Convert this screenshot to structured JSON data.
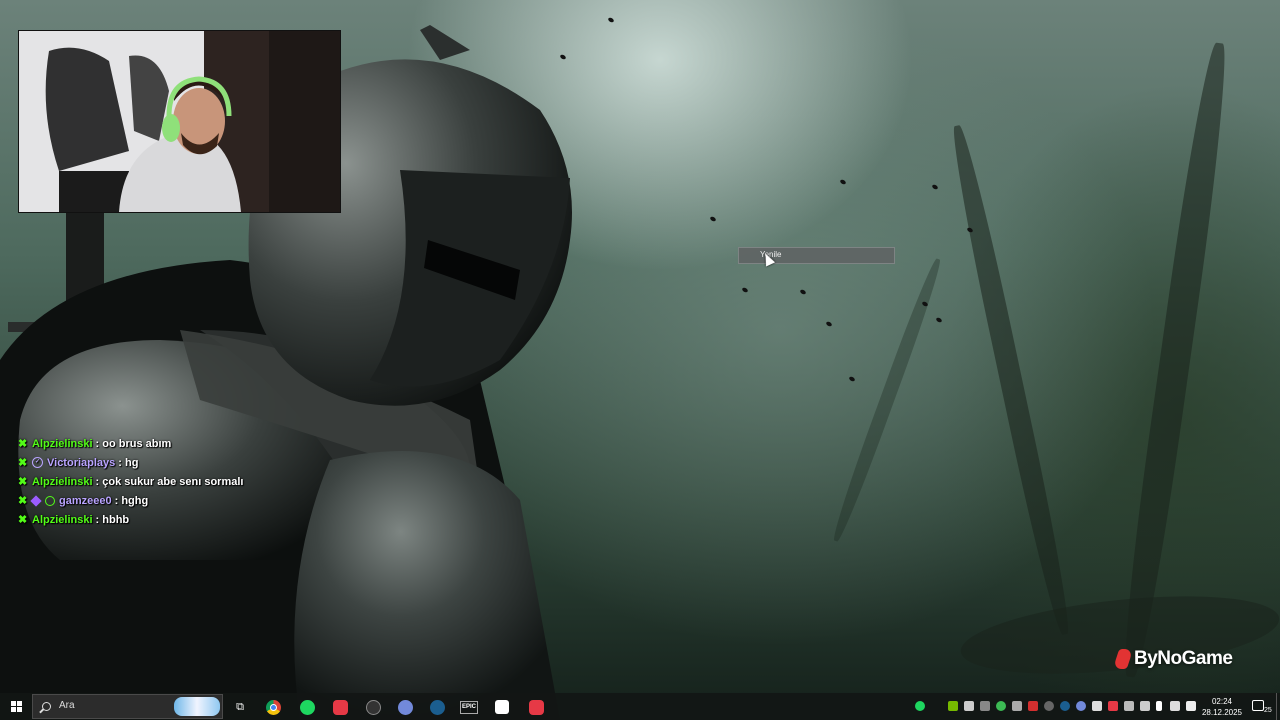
{
  "chat": {
    "messages": [
      {
        "user": "Alpzielinski",
        "text": ": oo brus abım",
        "color": "#53fc18",
        "badges": [
          "kick"
        ]
      },
      {
        "user": "Victoriaplays",
        "text": ": hg",
        "color": "#b9a4ff",
        "badges": [
          "verified"
        ]
      },
      {
        "user": "Alpzielinski",
        "text": ": çok sukur abe senı sormalı",
        "color": "#53fc18",
        "badges": [
          "kick"
        ]
      },
      {
        "user": "gamzeee0",
        "text": ": hghg",
        "color": "#b9a4ff",
        "badges": [
          "gem",
          "check"
        ]
      },
      {
        "user": "Alpzielinski",
        "text": ": hbhb",
        "color": "#53fc18",
        "badges": [
          "kick"
        ]
      }
    ]
  },
  "context_tooltip": {
    "label": "Yenile"
  },
  "watermark": {
    "text": "ByNoGame",
    "mark_color": "#e23333"
  },
  "taskbar": {
    "search_placeholder": "Ara",
    "pinned_apps": [
      "task-view-icon",
      "chrome-icon",
      "spotify-icon",
      "red-app-icon",
      "app-icon",
      "discord-icon",
      "steam-icon",
      "epic-games-icon",
      "capcut-icon",
      "red-app-icon"
    ],
    "epic_label": "EPIC",
    "clock": {
      "time": "02:24",
      "date": "28.12.2025"
    },
    "notification_count": "25"
  }
}
